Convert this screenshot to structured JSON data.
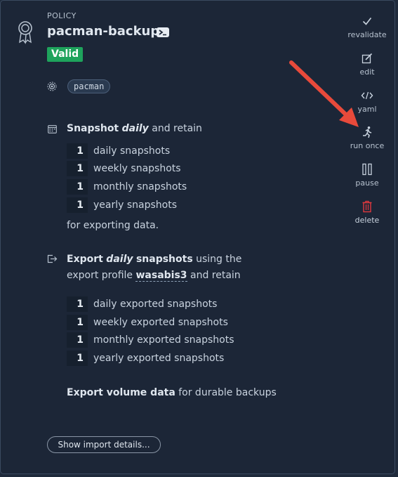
{
  "header": {
    "kicker": "POLICY",
    "title": "pacman-backup",
    "status": "Valid"
  },
  "target": {
    "label": "pacman"
  },
  "snapshot": {
    "prefix": "Snapshot",
    "frequency": "daily",
    "suffix": "and retain",
    "items": [
      {
        "count": "1",
        "label": "daily snapshots"
      },
      {
        "count": "1",
        "label": "weekly snapshots"
      },
      {
        "count": "1",
        "label": "monthly snapshots"
      },
      {
        "count": "1",
        "label": "yearly snapshots"
      }
    ],
    "footer": "for exporting data."
  },
  "export": {
    "prefix": "Export",
    "frequency": "daily",
    "object": "snapshots",
    "using": "using the",
    "profile_intro": "export profile",
    "profile": "wasabis3",
    "retain": "and retain",
    "items": [
      {
        "count": "1",
        "label": "daily exported snapshots"
      },
      {
        "count": "1",
        "label": "weekly exported snapshots"
      },
      {
        "count": "1",
        "label": "monthly exported snapshots"
      },
      {
        "count": "1",
        "label": "yearly exported snapshots"
      }
    ]
  },
  "volume": {
    "bold": "Export volume data",
    "rest": "for durable backups"
  },
  "import_button": "Show import details...",
  "actions": [
    {
      "label": "revalidate",
      "icon": "check-icon"
    },
    {
      "label": "edit",
      "icon": "edit-icon"
    },
    {
      "label": "yaml",
      "icon": "code-icon"
    },
    {
      "label": "run once",
      "icon": "run-icon"
    },
    {
      "label": "pause",
      "icon": "pause-icon"
    },
    {
      "label": "delete",
      "icon": "trash-icon"
    }
  ],
  "colors": {
    "background": "#1c2637",
    "valid": "#1ea35c",
    "delete": "#e0393e",
    "annotation_arrow": "#e84a3b"
  }
}
